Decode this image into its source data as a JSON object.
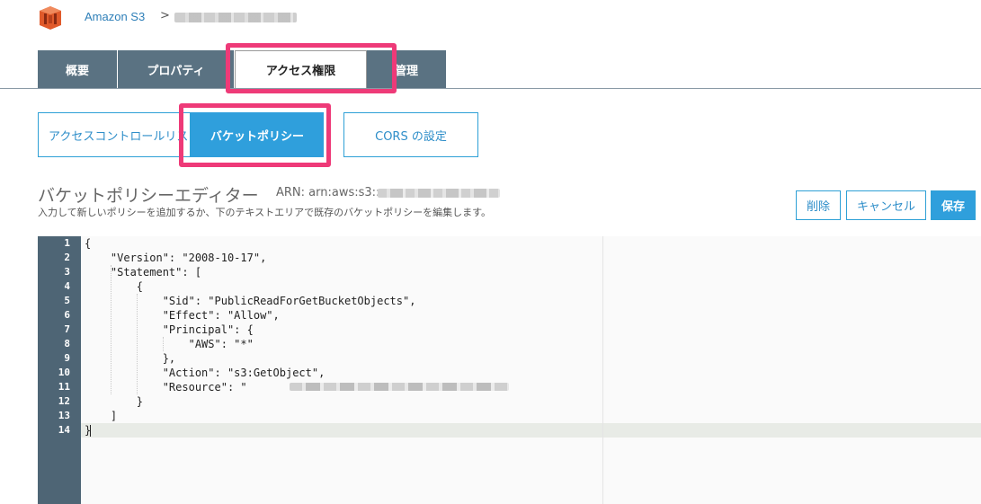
{
  "breadcrumb": {
    "root": "Amazon S3",
    "separator": ">"
  },
  "tabs": [
    {
      "label": "概要",
      "active": false
    },
    {
      "label": "プロパティ",
      "active": false
    },
    {
      "label": "アクセス権限",
      "active": true
    },
    {
      "label": "管理",
      "active": false
    }
  ],
  "subtabs": [
    {
      "label": "アクセスコントロールリスト",
      "active": false
    },
    {
      "label": "バケットポリシー",
      "active": true
    },
    {
      "label": "CORS の設定",
      "active": false
    }
  ],
  "editor": {
    "title": "バケットポリシーエディター",
    "arn_label": "ARN: arn:aws:s3::",
    "description": "入力して新しいポリシーを追加するか、下のテキストエリアで既存のバケットポリシーを編集します。",
    "buttons": {
      "delete": "削除",
      "cancel": "キャンセル",
      "save": "保存"
    },
    "line_numbers": [
      "1",
      "2",
      "3",
      "4",
      "5",
      "6",
      "7",
      "8",
      "9",
      "10",
      "11",
      "12",
      "13",
      "14"
    ],
    "code_lines": [
      "{",
      "    \"Version\": \"2008-10-17\",",
      "    \"Statement\": [",
      "        {",
      "            \"Sid\": \"PublicReadForGetBucketObjects\",",
      "            \"Effect\": \"Allow\",",
      "            \"Principal\": {",
      "                \"AWS\": \"*\"",
      "            },",
      "            \"Action\": \"s3:GetObject\",",
      "            \"Resource\": \"",
      "        }",
      "    ]",
      "}"
    ]
  },
  "colors": {
    "tab_bg": "#5a7282",
    "accent_blue": "#2f9fdc",
    "highlight_pink": "#ee3a78",
    "gutter_bg": "#4e6575"
  },
  "icons": {
    "logo": "amazon-s3-logo-icon"
  }
}
